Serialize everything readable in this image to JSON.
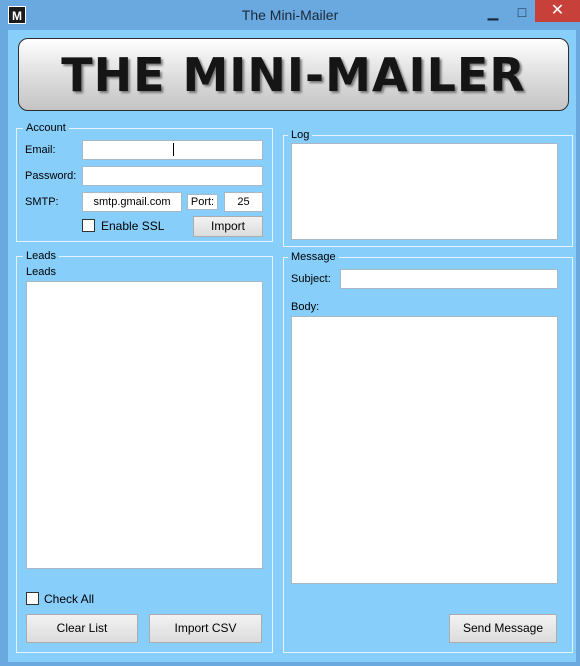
{
  "window": {
    "title": "The Mini-Mailer",
    "icon_letter": "M",
    "minimize_glyph": "▁",
    "maximize_glyph": "□",
    "close_glyph": "✕"
  },
  "banner": {
    "text": "THE MINI-MAILER"
  },
  "account": {
    "legend": "Account",
    "email_label": "Email:",
    "email_value": "",
    "password_label": "Password:",
    "password_value": "",
    "smtp_label": "SMTP:",
    "smtp_value": "smtp.gmail.com",
    "port_label": "Port:",
    "port_value": "25",
    "ssl_label": "Enable SSL",
    "import_button": "Import"
  },
  "log": {
    "legend": "Log",
    "content": ""
  },
  "leads": {
    "legend": "Leads",
    "list_label": "Leads",
    "check_all_label": "Check All",
    "clear_button": "Clear List",
    "import_csv_button": "Import CSV"
  },
  "message": {
    "legend": "Message",
    "subject_label": "Subject:",
    "subject_value": "",
    "body_label": "Body:",
    "body_value": "",
    "send_button": "Send Message"
  }
}
